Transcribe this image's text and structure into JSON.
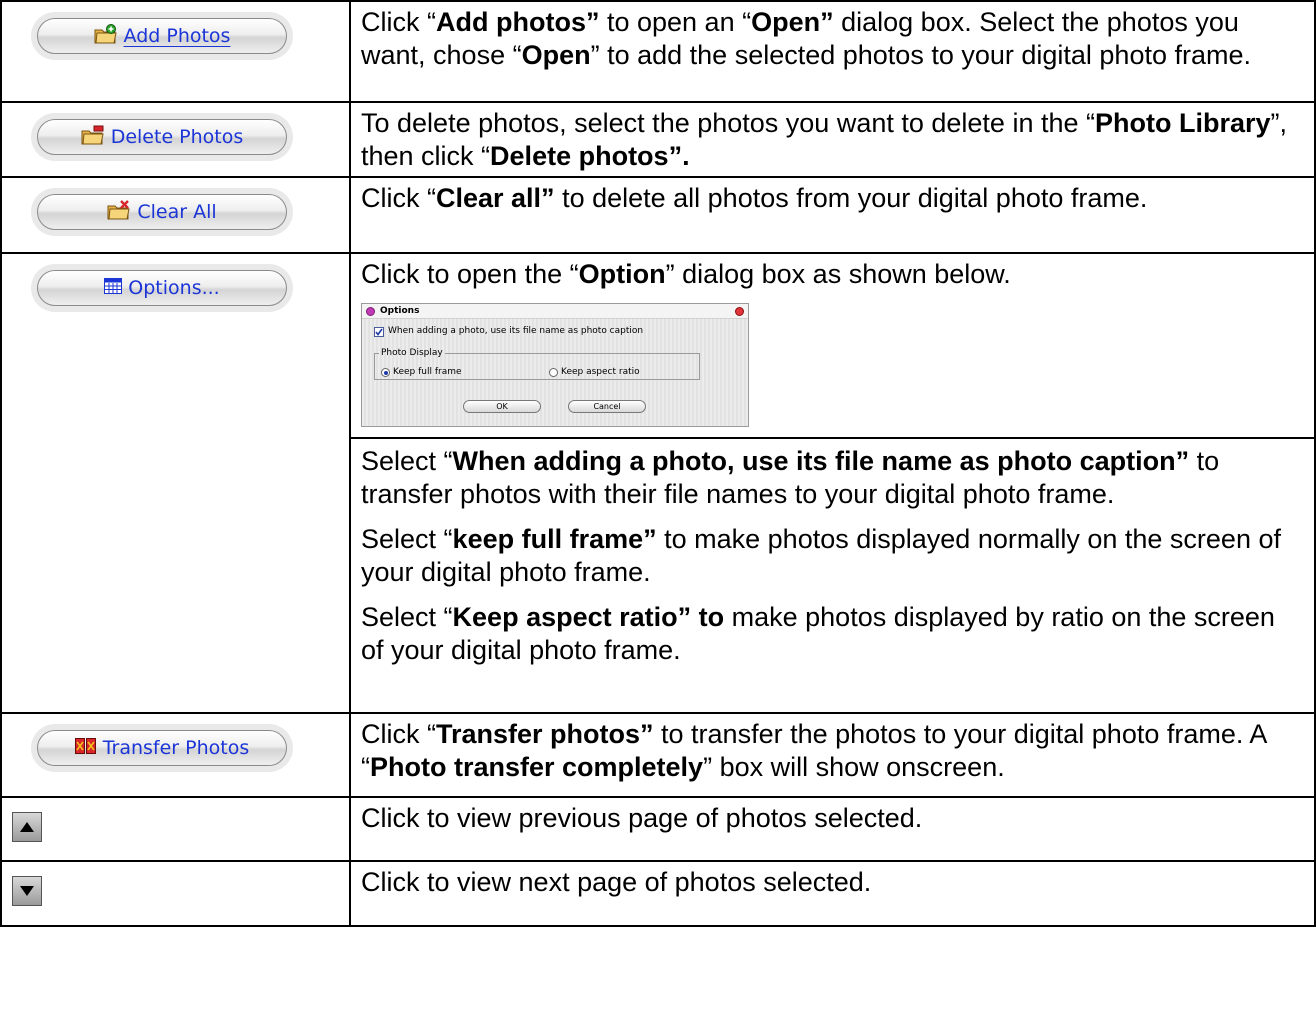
{
  "rows": {
    "add": {
      "button_label": "Add Photos",
      "icon": "folder-add-icon",
      "t1": "Click “",
      "b1": "Add photos”",
      "t2": " to open an “",
      "b2": "Open”",
      "t3": " dialog box. Select the photos you want, chose “",
      "b3": "Open",
      "t4": "” to add the selected photos to your digital photo frame."
    },
    "delete": {
      "button_label": "Delete Photos",
      "icon": "folder-delete-icon",
      "t1": "To delete photos, select the photos you want to delete in the “",
      "b1": "Photo Library",
      "t2": "”, then click “",
      "b2": "Delete photos”."
    },
    "clear": {
      "button_label": "Clear All",
      "icon": "folder-clear-icon",
      "t1": "Click “",
      "b1": "Clear all”",
      "t2": " to delete all photos from your digital photo frame."
    },
    "options": {
      "button_label": "Options...",
      "icon": "calendar-grid-icon",
      "t1": "Click to open the “",
      "b1": "Option",
      "t2": "” dialog box as shown below.",
      "dialog": {
        "title": "Options",
        "checkbox_label": "When adding a photo, use its file name as photo caption",
        "checkbox_checked": true,
        "group_label": "Photo Display",
        "radio_full": "Keep full frame",
        "radio_aspect": "Keep aspect ratio",
        "selected": "Keep full frame",
        "ok": "OK",
        "cancel": "Cancel"
      },
      "p1_t1": "Select “",
      "p1_b1": "When adding a photo, use its file name as photo caption”",
      "p1_t2": " to transfer photos with their file names to your digital photo frame.",
      "p2_t1": "Select “",
      "p2_b1": "keep full frame”",
      "p2_t2": " to make photos displayed normally on the screen of your digital photo frame.",
      "p3_t1": "Select “",
      "p3_b1": "Keep aspect ratio” to",
      "p3_t2": " make photos displayed by ratio on the screen of your digital photo frame."
    },
    "transfer": {
      "button_label": "Transfer Photos",
      "icon": "transfer-icon",
      "t1": "Click “",
      "b1": "Transfer photos”",
      "t2": " to transfer the photos to your digital photo frame. A “",
      "b2": "Photo transfer completely",
      "t3": "” box will show onscreen."
    },
    "prev": {
      "icon": "up-arrow-icon",
      "text": "Click to view previous page of photos selected."
    },
    "next": {
      "icon": "down-arrow-icon",
      "text": "Click to view next page of photos selected."
    }
  },
  "colors": {
    "button_text": "#1b35d6",
    "border": "#000000"
  }
}
